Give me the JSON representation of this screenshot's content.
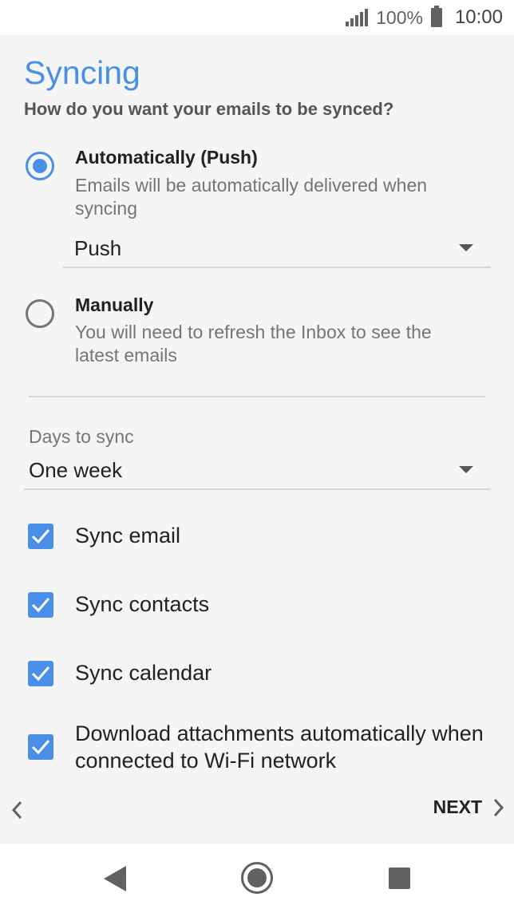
{
  "status_bar": {
    "battery_percent": "100%",
    "time": "10:00"
  },
  "page": {
    "title": "Syncing",
    "subtitle": "How do you want your emails to be synced?"
  },
  "sync_options": [
    {
      "title": "Automatically (Push)",
      "description": "Emails will be automatically delivered when syncing",
      "selected": true
    },
    {
      "title": "Manually",
      "description": "You will need to refresh the Inbox to see the latest emails",
      "selected": false
    }
  ],
  "push_dropdown": {
    "value": "Push"
  },
  "days_to_sync": {
    "label": "Days to sync",
    "value": "One week"
  },
  "checkboxes": [
    {
      "label": "Sync email",
      "checked": true
    },
    {
      "label": "Sync contacts",
      "checked": true
    },
    {
      "label": "Sync calendar",
      "checked": true
    },
    {
      "label": "Download attachments automatically when connected to Wi-Fi network",
      "checked": true
    }
  ],
  "navigation": {
    "next_label": "NEXT"
  },
  "colors": {
    "accent": "#4a8fe7",
    "text_primary": "#212121",
    "text_secondary": "#757575"
  }
}
